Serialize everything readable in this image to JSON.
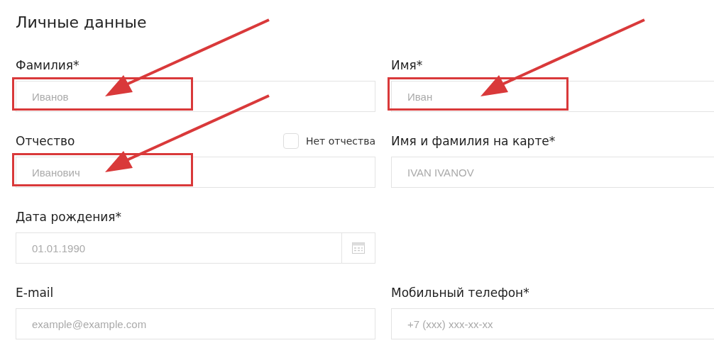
{
  "section_title": "Личные данные",
  "rows": [
    {
      "fields": [
        {
          "kind": "text",
          "label": "Фамилия*",
          "placeholder": "Иванов",
          "highlighted": true
        },
        {
          "kind": "text",
          "label": "Имя*",
          "placeholder": "Иван",
          "highlighted": true
        }
      ]
    },
    {
      "fields": [
        {
          "kind": "text",
          "label": "Отчество",
          "placeholder": "Иванович",
          "highlighted": true,
          "checkbox": {
            "label": "Нет отчества",
            "checked": false
          }
        },
        {
          "kind": "text",
          "label": "Имя и фамилия на карте*",
          "placeholder": "IVAN IVANOV",
          "highlighted": false
        }
      ]
    },
    {
      "fields": [
        {
          "kind": "date",
          "label": "Дата рождения*",
          "placeholder": "01.01.1990",
          "highlighted": false
        }
      ]
    },
    {
      "fields": [
        {
          "kind": "text",
          "label": "E-mail",
          "placeholder": "example@example.com",
          "highlighted": false
        },
        {
          "kind": "text",
          "label": "Мобильный телефон*",
          "placeholder": "+7 (xxx) xxx-xx-xx",
          "highlighted": false
        }
      ]
    }
  ]
}
